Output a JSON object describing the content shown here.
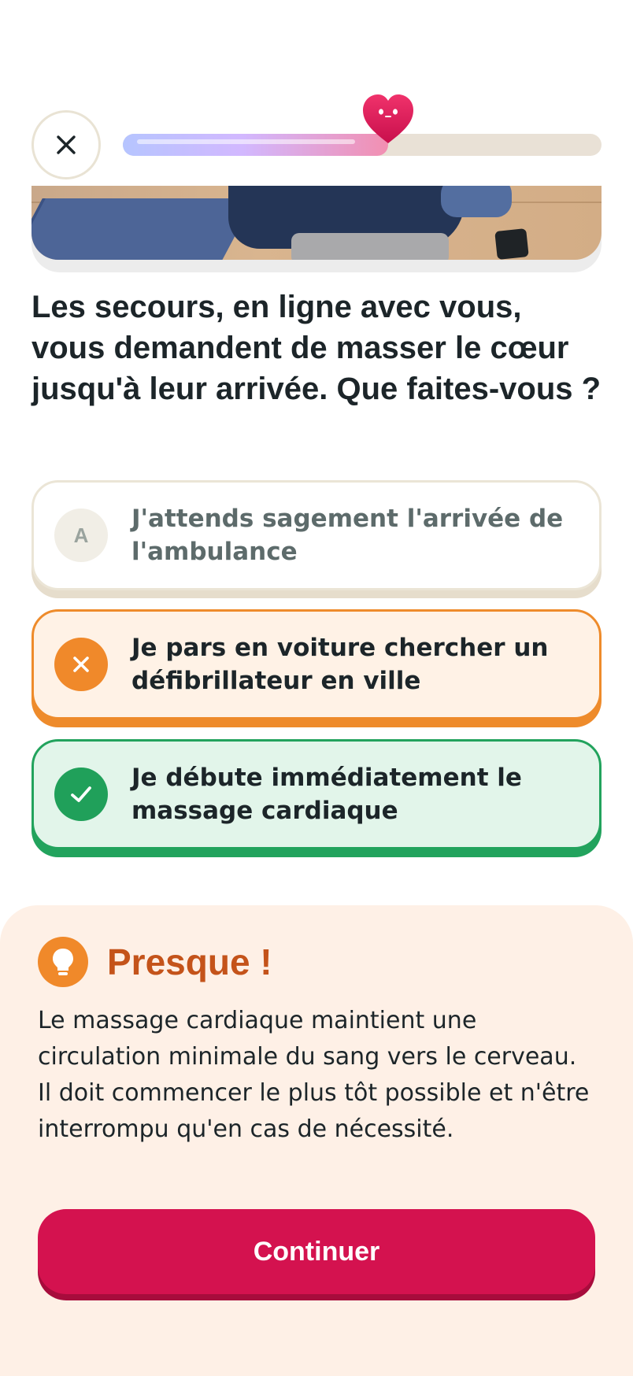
{
  "header": {
    "close_icon": "close-icon",
    "progress": 0.555
  },
  "question": {
    "text": "Les secours, en ligne avec vous, vous demandent de masser le cœur jusqu'à leur arrivée. Que faites-vous ?"
  },
  "answers": [
    {
      "letter": "A",
      "label": "J'attends sagement l'arrivée de l'ambulance",
      "state": "neutral"
    },
    {
      "icon": "x-icon",
      "label": "Je pars en voiture chercher un défibrillateur en ville",
      "state": "wrong"
    },
    {
      "icon": "check-icon",
      "label": "Je débute immédiatement le massage cardiaque",
      "state": "correct"
    }
  ],
  "feedback": {
    "icon": "lightbulb-icon",
    "title": "Presque !",
    "body": "Le massage cardiaque maintient une circulation minimale du sang vers le cerveau. Il doit commencer le plus tôt possible et n'être interrompu qu'en cas de nécessité.",
    "continue_label": "Continuer"
  },
  "colors": {
    "accent": "#d4124f",
    "wrong": "#ee8b2b",
    "correct": "#22a35d",
    "feedback_title": "#c4531a"
  }
}
